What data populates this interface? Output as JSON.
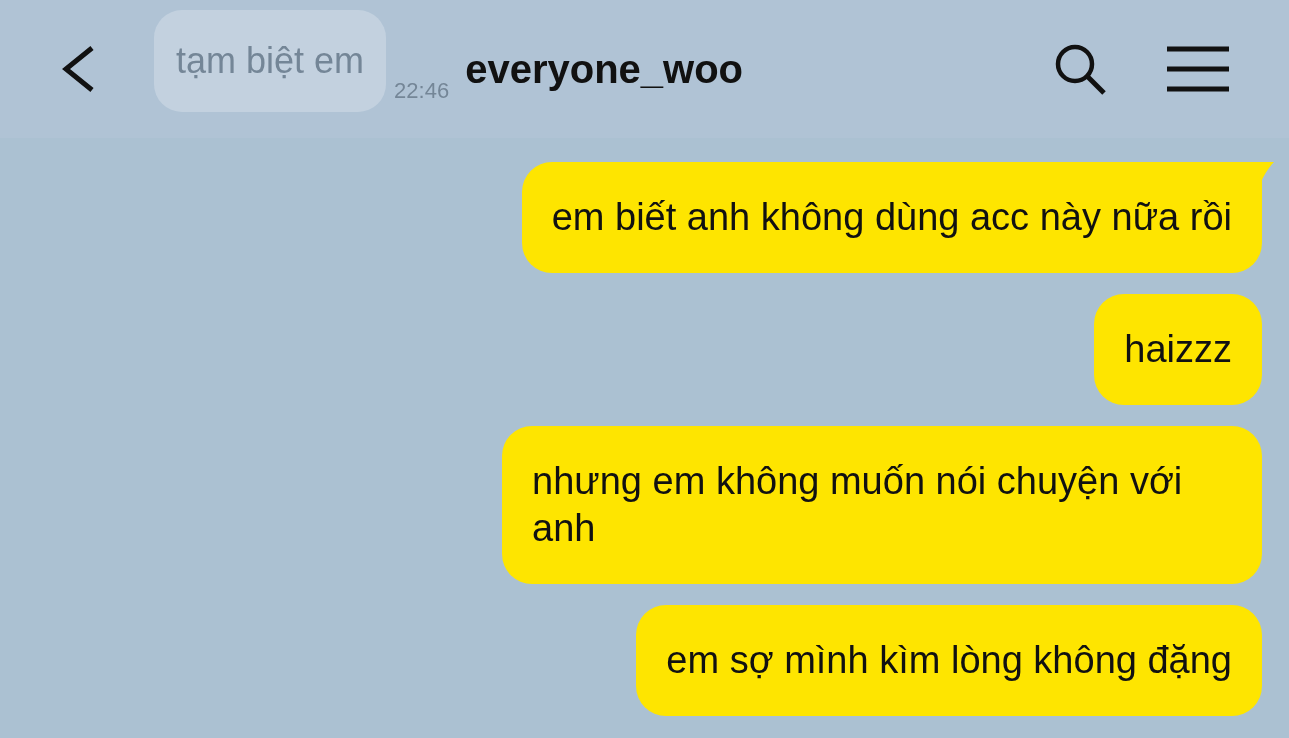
{
  "header": {
    "title": "everyone_woo",
    "faded_message": {
      "text": "tạm biệt em",
      "time": "22:46"
    }
  },
  "messages": [
    {
      "text": "em biết anh không dùng acc này nữa rồi",
      "tail": true
    },
    {
      "text": "haizzz",
      "tail": false
    },
    {
      "text": "nhưng em không muốn nói chuyện với anh",
      "tail": false
    },
    {
      "text": "em sợ mình kìm lòng không đặng",
      "tail": false
    }
  ]
}
